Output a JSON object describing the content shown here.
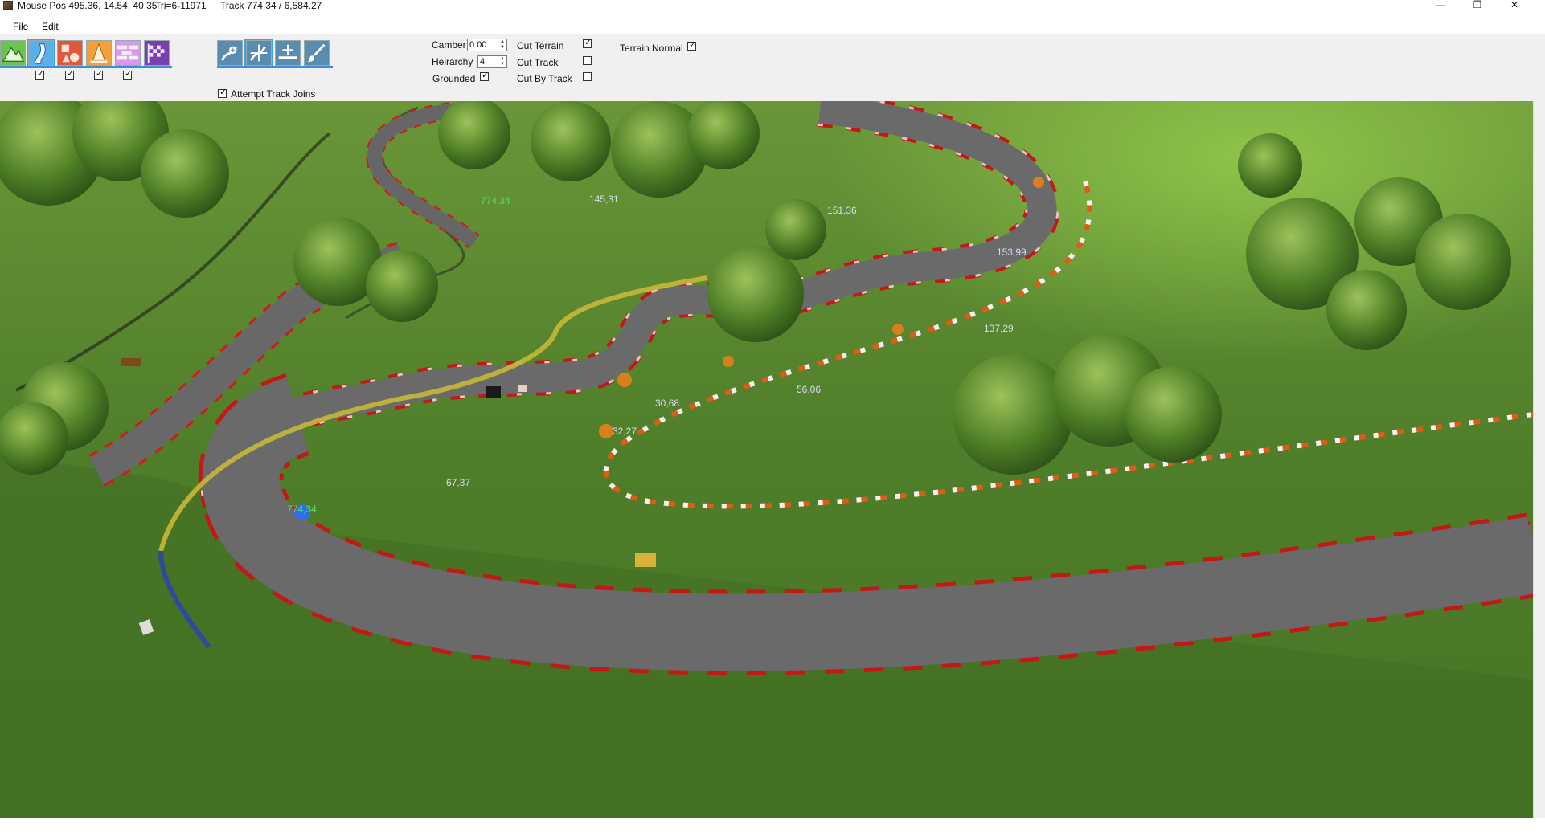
{
  "title": {
    "mouse_pos": "Mouse Pos 495.36, 14.54, 40.35",
    "tri": "Tri=6-11971",
    "track": "Track 774.34 / 6,584.27"
  },
  "window_controls": {
    "minimize": "—",
    "maximize": "❐",
    "close": "✕"
  },
  "menu": [
    {
      "label": "File"
    },
    {
      "label": "Edit"
    }
  ],
  "toolbar": {
    "mode_tools": [
      {
        "name": "terrain-tool",
        "icon": "mountain-icon",
        "color": "#5dbb46"
      },
      {
        "name": "track-tool",
        "icon": "road-icon",
        "color": "#5ab0e6"
      },
      {
        "name": "objects-tool",
        "icon": "shapes-icon",
        "color": "#e2573a"
      },
      {
        "name": "scenery-tool",
        "icon": "cones-icon",
        "color": "#f2a03a"
      },
      {
        "name": "walls-tool",
        "icon": "bricks-icon",
        "color": "#d89ae8"
      },
      {
        "name": "finish-tool",
        "icon": "checkered-flag-icon",
        "color": "#7a3fae"
      }
    ],
    "mode_visibility": [
      true,
      true,
      true,
      true
    ],
    "edit_tools": [
      {
        "name": "add-node-tool",
        "icon": "add-node-icon"
      },
      {
        "name": "move-node-tool",
        "icon": "move-node-icon"
      },
      {
        "name": "insert-node-tool",
        "icon": "insert-node-icon"
      },
      {
        "name": "paint-tool",
        "icon": "paint-brush-icon"
      }
    ],
    "attempt_track_joins": {
      "label": "Attempt Track Joins",
      "checked": true
    },
    "camber": {
      "label": "Camber",
      "value": "0.00"
    },
    "heirarchy": {
      "label": "Heirarchy",
      "value": "4"
    },
    "grounded": {
      "label": "Grounded",
      "checked": true
    },
    "cut_terrain": {
      "label": "Cut Terrain",
      "checked": true
    },
    "cut_track": {
      "label": "Cut Track",
      "checked": false
    },
    "cut_by_track": {
      "label": "Cut By Track",
      "checked": false
    },
    "terrain_normal": {
      "label": "Terrain Normal",
      "checked": true
    }
  },
  "viewport": {
    "colors": {
      "grass": "#4a7a28",
      "asphalt": "#6a6a6a",
      "kerb_red": "#c41818",
      "kerb_white": "#f2f2f2",
      "node": "#d9801e",
      "selected_node": "#2f6fe6"
    },
    "distance_markers": [
      "774,34",
      "145,31",
      "151,36",
      "153,99",
      "137,29",
      "56,06",
      "30,68",
      "32,27",
      "67,37",
      "774,34"
    ]
  }
}
